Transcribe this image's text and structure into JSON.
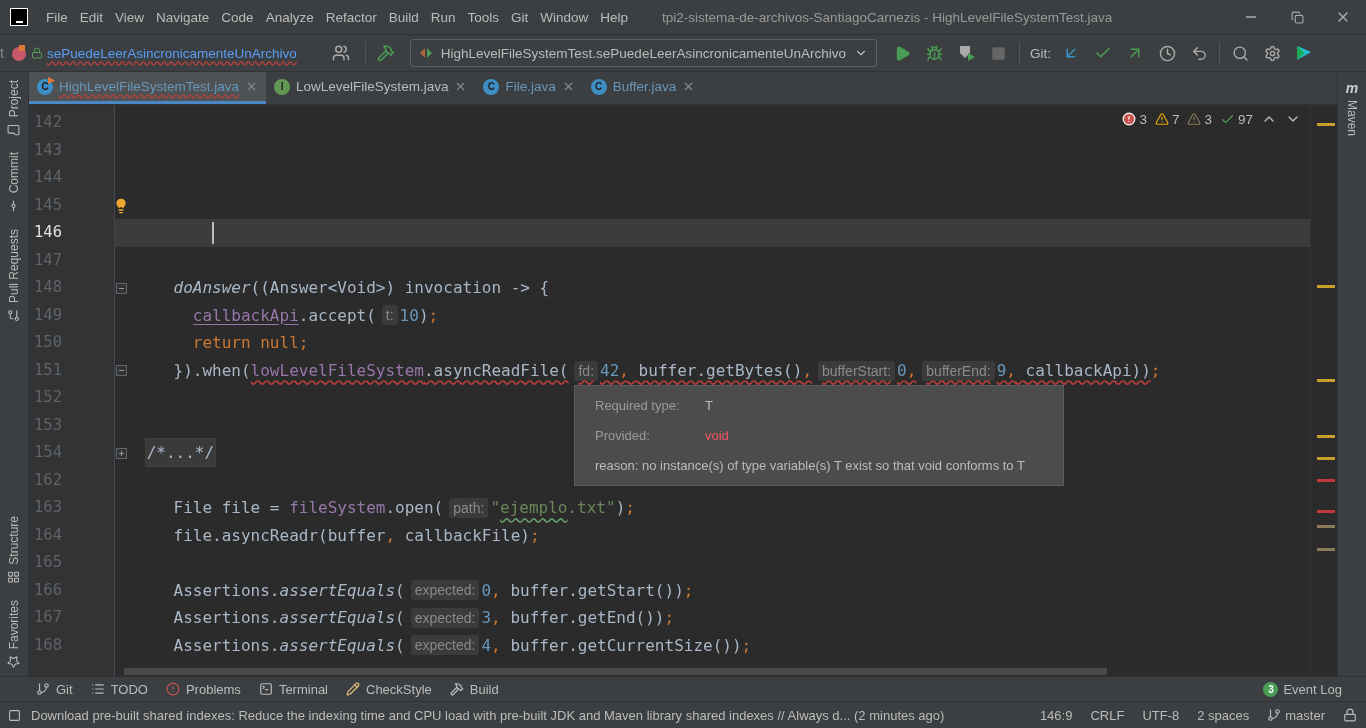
{
  "window": {
    "title": "tpi2-sistema-de-archivos-SantiagoCarnezis - HighLevelFileSystemTest.java"
  },
  "menu": [
    "File",
    "Edit",
    "View",
    "Navigate",
    "Code",
    "Analyze",
    "Refactor",
    "Build",
    "Run",
    "Tools",
    "Git",
    "Window",
    "Help"
  ],
  "toolbar": {
    "breadcrumb_cut": "t",
    "breadcrumb": "sePuedeLeerAsincronicamenteUnArchivo",
    "run_config": "HighLevelFileSystemTest.sePuedeLeerAsincronicamenteUnArchivo",
    "git_label": "Git:"
  },
  "left_tools": [
    "Project",
    "Commit",
    "Pull Requests",
    "Structure",
    "Favorites"
  ],
  "right_tools": [
    {
      "label": "Maven",
      "icon_letter": "m"
    }
  ],
  "tabs": [
    {
      "label": "HighLevelFileSystemTest.java",
      "kind": "test",
      "icon_letter": "C",
      "modified": true,
      "has_errors": true,
      "selected": true
    },
    {
      "label": "LowLevelFileSystem.java",
      "kind": "interface",
      "icon_letter": "I",
      "modified": false,
      "has_errors": false,
      "selected": false
    },
    {
      "label": "File.java",
      "kind": "class",
      "icon_letter": "C",
      "modified": true,
      "has_errors": false,
      "selected": false
    },
    {
      "label": "Buffer.java",
      "kind": "class",
      "icon_letter": "C",
      "modified": true,
      "has_errors": false,
      "selected": false
    }
  ],
  "inspections": {
    "errors": "3",
    "warnings": "7",
    "weak_warnings": "3",
    "typos": "97"
  },
  "lines": [
    {
      "number": "142",
      "kind": "plain",
      "current": false
    },
    {
      "number": "143",
      "kind": "plain",
      "current": false
    },
    {
      "number": "144",
      "kind": "plain",
      "current": false
    },
    {
      "number": "145",
      "kind": "bulb",
      "current": false
    },
    {
      "number": "146",
      "kind": "plain",
      "current": true
    },
    {
      "number": "147",
      "kind": "plain",
      "current": false
    },
    {
      "number": "148",
      "kind": "foldable",
      "current": false,
      "tokens": [
        {
          "kind": "italic",
          "text": "    doAnswer"
        },
        {
          "kind": "text",
          "text": "((Answer<Void>) invocation -> {"
        }
      ]
    },
    {
      "number": "149",
      "kind": "plain",
      "current": false,
      "tokens": [
        {
          "kind": "field",
          "text": "      callbackApi"
        },
        {
          "kind": "text",
          "text": ".accept("
        },
        {
          "kind": "hint",
          "text": "t:"
        },
        {
          "kind": "number",
          "text": "10"
        },
        {
          "kind": "text",
          "text": ")"
        },
        {
          "kind": "punct",
          "text": ";"
        }
      ]
    },
    {
      "number": "150",
      "kind": "plain",
      "current": false,
      "tokens": [
        {
          "kind": "keyword",
          "text": "      return null"
        },
        {
          "kind": "punct",
          "text": ";"
        }
      ]
    },
    {
      "number": "151",
      "kind": "foldable",
      "current": false,
      "tokens": [
        {
          "kind": "text",
          "text": "    }).when("
        },
        {
          "kind": "error",
          "tokens": [
            {
              "kind": "field",
              "text": "lowLevelFileSystem"
            },
            {
              "kind": "text",
              "text": ".asyncReadFile("
            },
            {
              "kind": "hint",
              "text": "fd:"
            },
            {
              "kind": "number",
              "text": "42"
            },
            {
              "kind": "punct",
              "text": ","
            },
            {
              "kind": "text",
              "text": " buffer.getBytes()"
            },
            {
              "kind": "punct",
              "text": ","
            },
            {
              "kind": "hint",
              "text": "bufferStart:"
            },
            {
              "kind": "number",
              "text": "0"
            },
            {
              "kind": "punct",
              "text": ","
            },
            {
              "kind": "hint",
              "text": "bufferEnd:"
            },
            {
              "kind": "number",
              "text": "9"
            },
            {
              "kind": "punct",
              "text": ","
            },
            {
              "kind": "text",
              "text": " callbackApi))"
            }
          ]
        },
        {
          "kind": "punct",
          "text": ";"
        }
      ]
    },
    {
      "number": "152",
      "kind": "plain",
      "current": false
    },
    {
      "number": "153",
      "kind": "plain",
      "current": false
    },
    {
      "number": "154",
      "kind": "collapsed",
      "current": false,
      "tokens": [
        {
          "kind": "folded",
          "text": " /*...*/"
        }
      ]
    },
    {
      "number": "162",
      "kind": "plain",
      "current": false
    },
    {
      "number": "163",
      "kind": "plain",
      "current": false,
      "tokens": [
        {
          "kind": "text",
          "text": "    File file = "
        },
        {
          "kind": "field",
          "text": "fileSystem"
        },
        {
          "kind": "text",
          "text": ".open("
        },
        {
          "kind": "hint",
          "text": "path:"
        },
        {
          "kind": "string",
          "text": "\""
        },
        {
          "kind": "typo",
          "text": "ejemplo"
        },
        {
          "kind": "string",
          "text": ".txt\""
        },
        {
          "kind": "text",
          "text": ")"
        },
        {
          "kind": "punct",
          "text": ";"
        }
      ]
    },
    {
      "number": "164",
      "kind": "plain",
      "current": false,
      "tokens": [
        {
          "kind": "text",
          "text": "    file.asyncReadr(buffer"
        },
        {
          "kind": "punct",
          "text": ","
        },
        {
          "kind": "text",
          "text": " callbackFile)"
        },
        {
          "kind": "punct",
          "text": ";"
        }
      ]
    },
    {
      "number": "165",
      "kind": "plain",
      "current": false
    },
    {
      "number": "166",
      "kind": "plain",
      "current": false,
      "tokens": [
        {
          "kind": "text",
          "text": "    Assertions."
        },
        {
          "kind": "italic",
          "text": "assertEquals"
        },
        {
          "kind": "text",
          "text": "("
        },
        {
          "kind": "hint",
          "text": "expected:"
        },
        {
          "kind": "number",
          "text": "0"
        },
        {
          "kind": "punct",
          "text": ","
        },
        {
          "kind": "text",
          "text": " buffer.getStart())"
        },
        {
          "kind": "punct",
          "text": ";"
        }
      ]
    },
    {
      "number": "167",
      "kind": "plain",
      "current": false,
      "tokens": [
        {
          "kind": "text",
          "text": "    Assertions."
        },
        {
          "kind": "italic",
          "text": "assertEquals"
        },
        {
          "kind": "text",
          "text": "("
        },
        {
          "kind": "hint",
          "text": "expected:"
        },
        {
          "kind": "number",
          "text": "3"
        },
        {
          "kind": "punct",
          "text": ","
        },
        {
          "kind": "text",
          "text": " buffer.getEnd())"
        },
        {
          "kind": "punct",
          "text": ";"
        }
      ]
    },
    {
      "number": "168",
      "kind": "plain",
      "current": false,
      "tokens": [
        {
          "kind": "text",
          "text": "    Assertions."
        },
        {
          "kind": "italic",
          "text": "assertEquals"
        },
        {
          "kind": "text",
          "text": "("
        },
        {
          "kind": "hint",
          "text": "expected:"
        },
        {
          "kind": "number",
          "text": "4"
        },
        {
          "kind": "punct",
          "text": ","
        },
        {
          "kind": "text",
          "text": " buffer.getCurrentSize())"
        },
        {
          "kind": "punct",
          "text": ";"
        }
      ]
    }
  ],
  "tooltip": {
    "rows": [
      {
        "label": "Required type:",
        "value": "T",
        "kind": "normal"
      },
      {
        "label": "Provided:",
        "value": "void",
        "kind": "error"
      }
    ],
    "reason": "reason: no instance(s) of type variable(s) T exist so that void conforms to T"
  },
  "bottom_tools": [
    "Git",
    "TODO",
    "Problems",
    "Terminal",
    "CheckStyle",
    "Build"
  ],
  "event_log": {
    "label": "Event Log",
    "count": "3"
  },
  "status_bar": {
    "message": "Download pre-built shared indexes: Reduce the indexing time and CPU load with pre-built JDK and Maven library shared indexes // Always d... (2 minutes ago)",
    "position": "146:9",
    "line_ending": "CRLF",
    "encoding": "UTF-8",
    "indent": "2 spaces",
    "branch": "master"
  }
}
